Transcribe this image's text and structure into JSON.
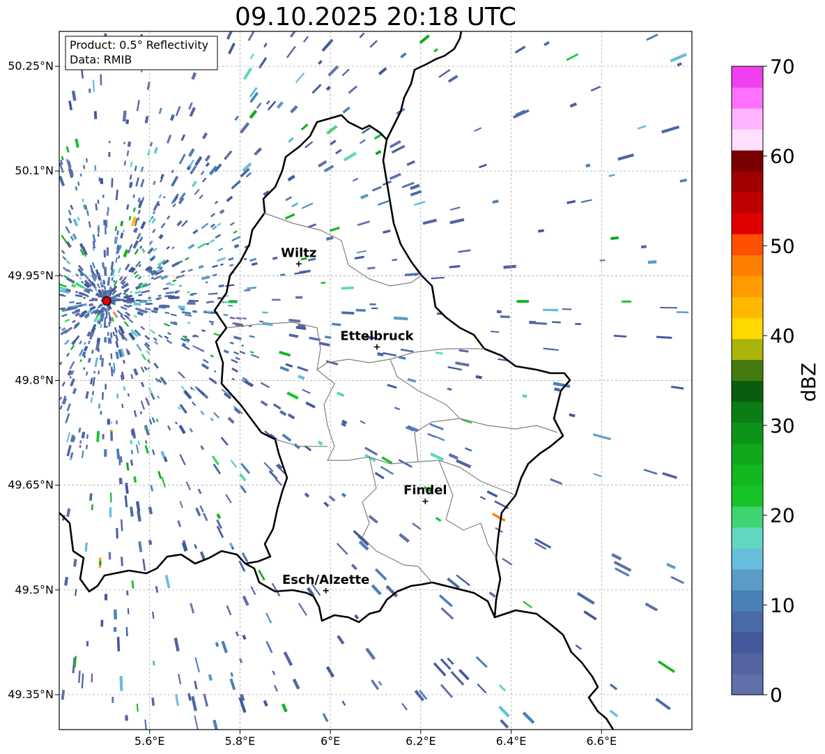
{
  "title": "09.10.2025 20:18 UTC",
  "info_box": {
    "line1": "Product: 0.5° Reflectivity",
    "line2": "Data: RMIB"
  },
  "map": {
    "lon_range": [
      5.4,
      6.8
    ],
    "lat_range": [
      49.3,
      50.3
    ],
    "lon_ticks": [
      "5.6°E",
      "5.8°E",
      "6°E",
      "6.2°E",
      "6.4°E",
      "6.6°E"
    ],
    "lat_ticks": [
      "50.25°N",
      "50.1°N",
      "49.95°N",
      "49.8°N",
      "49.65°N",
      "49.5°N",
      "49.35°N"
    ],
    "grid": true,
    "radar_site": {
      "lon": 5.505,
      "lat": 49.914
    },
    "cities": [
      {
        "name": "Wiltz",
        "lon": 5.93,
        "lat": 49.967
      },
      {
        "name": "Ettelbruck",
        "lon": 6.103,
        "lat": 49.848
      },
      {
        "name": "Findel",
        "lon": 6.21,
        "lat": 49.627
      },
      {
        "name": "Esch/Alzette",
        "lon": 5.99,
        "lat": 49.499
      }
    ]
  },
  "colorbar": {
    "label": "dBZ",
    "ticks": [
      "0",
      "10",
      "20",
      "30",
      "40",
      "50",
      "60",
      "70"
    ],
    "colors": [
      "#6070a8",
      "#5464a0",
      "#44589e",
      "#4a6aa8",
      "#4a80b8",
      "#5a9cc6",
      "#66bedc",
      "#60d8c0",
      "#3ed470",
      "#16c42a",
      "#12b81e",
      "#10a81a",
      "#0c9418",
      "#0a7e14",
      "#085e0e",
      "#447a10",
      "#aab40a",
      "#ffd800",
      "#ffb800",
      "#ff9c00",
      "#ff7e00",
      "#ff5000",
      "#e00000",
      "#c00000",
      "#a00000",
      "#780000",
      "#ffe0ff",
      "#ffb4ff",
      "#ff70ff",
      "#ee40ee"
    ]
  }
}
